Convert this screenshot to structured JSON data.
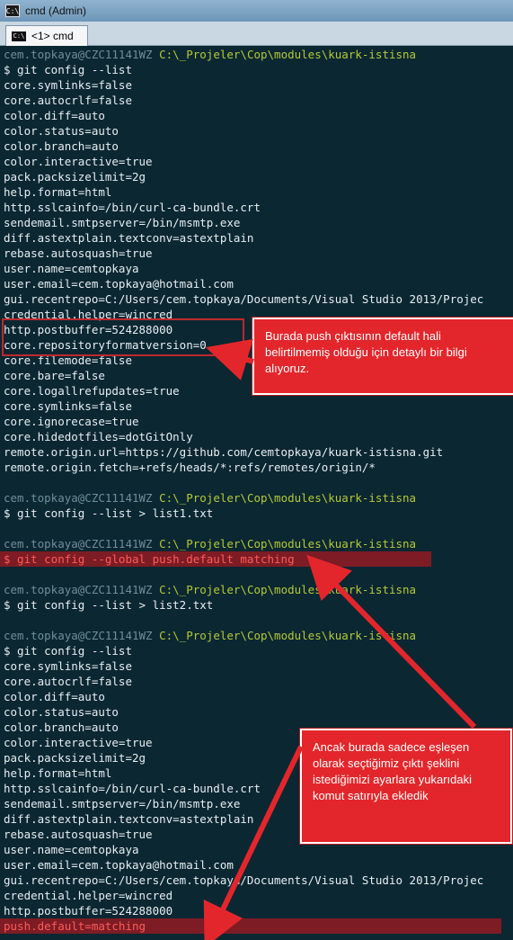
{
  "window": {
    "title": "cmd (Admin)",
    "tab_label": "<1>  cmd"
  },
  "console": {
    "lines": [
      {
        "kind": "prompt",
        "user": "cem.topkaya@CZC11141WZ",
        "path": "C:\\_Projeler\\Cop\\modules\\kuark-istisna"
      },
      {
        "kind": "text",
        "text": "$ git config --list"
      },
      {
        "kind": "text",
        "text": "core.symlinks=false"
      },
      {
        "kind": "text",
        "text": "core.autocrlf=false"
      },
      {
        "kind": "text",
        "text": "color.diff=auto"
      },
      {
        "kind": "text",
        "text": "color.status=auto"
      },
      {
        "kind": "text",
        "text": "color.branch=auto"
      },
      {
        "kind": "text",
        "text": "color.interactive=true"
      },
      {
        "kind": "text",
        "text": "pack.packsizelimit=2g"
      },
      {
        "kind": "text",
        "text": "help.format=html"
      },
      {
        "kind": "text",
        "text": "http.sslcainfo=/bin/curl-ca-bundle.crt"
      },
      {
        "kind": "text",
        "text": "sendemail.smtpserver=/bin/msmtp.exe"
      },
      {
        "kind": "text",
        "text": "diff.astextplain.textconv=astextplain"
      },
      {
        "kind": "text",
        "text": "rebase.autosquash=true"
      },
      {
        "kind": "text",
        "text": "user.name=cemtopkaya"
      },
      {
        "kind": "text",
        "text": "user.email=cem.topkaya@hotmail.com"
      },
      {
        "kind": "text",
        "text": "gui.recentrepo=C:/Users/cem.topkaya/Documents/Visual Studio 2013/Projec"
      },
      {
        "kind": "text",
        "text": "credential.helper=wincred"
      },
      {
        "kind": "text",
        "text": "http.postbuffer=524288000"
      },
      {
        "kind": "text",
        "text": "core.repositoryformatversion=0"
      },
      {
        "kind": "text",
        "text": "core.filemode=false"
      },
      {
        "kind": "text",
        "text": "core.bare=false"
      },
      {
        "kind": "text",
        "text": "core.logallrefupdates=true"
      },
      {
        "kind": "text",
        "text": "core.symlinks=false"
      },
      {
        "kind": "text",
        "text": "core.ignorecase=true"
      },
      {
        "kind": "text",
        "text": "core.hidedotfiles=dotGitOnly"
      },
      {
        "kind": "text",
        "text": "remote.origin.url=https://github.com/cemtopkaya/kuark-istisna.git"
      },
      {
        "kind": "text",
        "text": "remote.origin.fetch=+refs/heads/*:refs/remotes/origin/*"
      },
      {
        "kind": "blank",
        "text": ""
      },
      {
        "kind": "prompt",
        "user": "cem.topkaya@CZC11141WZ",
        "path": "C:\\_Projeler\\Cop\\modules\\kuark-istisna"
      },
      {
        "kind": "text",
        "text": "$ git config --list > list1.txt"
      },
      {
        "kind": "blank",
        "text": ""
      },
      {
        "kind": "prompt",
        "user": "cem.topkaya@CZC11141WZ",
        "path": "C:\\_Projeler\\Cop\\modules\\kuark-istisna"
      },
      {
        "kind": "highlight",
        "text": "$ git config --global push.default matching"
      },
      {
        "kind": "blank",
        "text": ""
      },
      {
        "kind": "prompt",
        "user": "cem.topkaya@CZC11141WZ",
        "path": "C:\\_Projeler\\Cop\\modules\\kuark-istisna"
      },
      {
        "kind": "text",
        "text": "$ git config --list > list2.txt"
      },
      {
        "kind": "blank",
        "text": ""
      },
      {
        "kind": "prompt",
        "user": "cem.topkaya@CZC11141WZ",
        "path": "C:\\_Projeler\\Cop\\modules\\kuark-istisna"
      },
      {
        "kind": "text",
        "text": "$ git config --list"
      },
      {
        "kind": "text",
        "text": "core.symlinks=false"
      },
      {
        "kind": "text",
        "text": "core.autocrlf=false"
      },
      {
        "kind": "text",
        "text": "color.diff=auto"
      },
      {
        "kind": "text",
        "text": "color.status=auto"
      },
      {
        "kind": "text",
        "text": "color.branch=auto"
      },
      {
        "kind": "text",
        "text": "color.interactive=true"
      },
      {
        "kind": "text",
        "text": "pack.packsizelimit=2g"
      },
      {
        "kind": "text",
        "text": "help.format=html"
      },
      {
        "kind": "text",
        "text": "http.sslcainfo=/bin/curl-ca-bundle.crt"
      },
      {
        "kind": "text",
        "text": "sendemail.smtpserver=/bin/msmtp.exe"
      },
      {
        "kind": "text",
        "text": "diff.astextplain.textconv=astextplain"
      },
      {
        "kind": "text",
        "text": "rebase.autosquash=true"
      },
      {
        "kind": "text",
        "text": "user.name=cemtopkaya"
      },
      {
        "kind": "text",
        "text": "user.email=cem.topkaya@hotmail.com"
      },
      {
        "kind": "text",
        "text": "gui.recentrepo=C:/Users/cem.topkaya/Documents/Visual Studio 2013/Projec"
      },
      {
        "kind": "text",
        "text": "credential.helper=wincred"
      },
      {
        "kind": "text",
        "text": "http.postbuffer=524288000"
      },
      {
        "kind": "highlight_wide",
        "text": "push.default=matching"
      }
    ]
  },
  "annotations": {
    "callout_1": "Burada push çıktısının default hali belirtilmemiş olduğu için detaylı bir bilgi alıyoruz.",
    "callout_2": "Ancak burada sadece eşleşen olarak seçtiğimiz çıktı şeklini istediğimizi ayarlara yukarıdaki komut satırıyla ekledik"
  },
  "colors": {
    "background": "#0b2732",
    "prompt_user": "#6f8e9a",
    "prompt_path": "#b7c936",
    "highlight_bg": "#7d1c24",
    "highlight_text": "#ff5a5a",
    "callout_bg": "#e3262b"
  }
}
